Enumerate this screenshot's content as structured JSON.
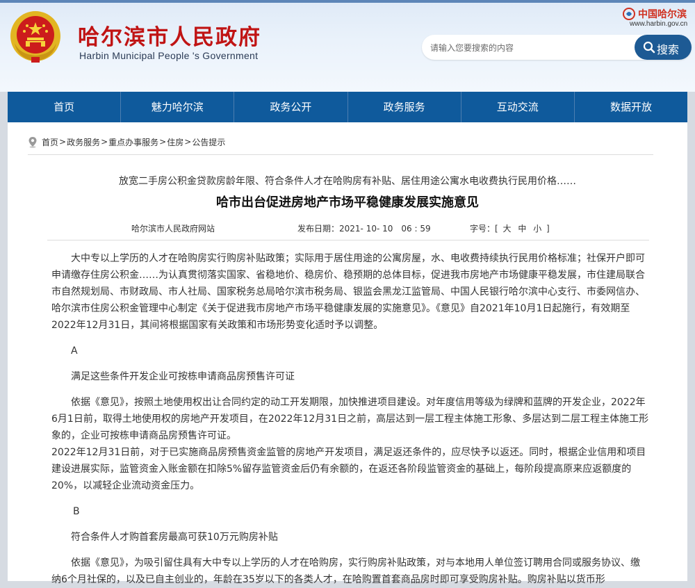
{
  "header": {
    "title_cn": "哈尔滨市人民政府",
    "title_en": "Harbin Municipal People 's Government",
    "china_logo_text": "中国哈尔滨",
    "site_url": "www.harbin.gov.cn"
  },
  "search": {
    "placeholder": "请输入您要搜索的内容",
    "button_label": "搜索"
  },
  "nav": {
    "items": [
      {
        "label": "首页"
      },
      {
        "label": "魅力哈尔滨"
      },
      {
        "label": "政务公开"
      },
      {
        "label": "政务服务"
      },
      {
        "label": "互动交流"
      },
      {
        "label": "数据开放"
      }
    ]
  },
  "breadcrumb": {
    "items": [
      "首页",
      "政务服务",
      "重点办事服务",
      "住房",
      "公告提示"
    ],
    "separator": ">"
  },
  "article": {
    "subtitle": "放宽二手房公积金贷款房龄年限、符合条件人才在哈购房有补贴、居住用途公寓水电收费执行民用价格……",
    "title": "哈市出台促进房地产市场平稳健康发展实施意见",
    "source": "哈尔滨市人民政府网站",
    "date_label": "发布日期：",
    "date": "2021- 10- 10　06 : 59",
    "font_label": "字号：[",
    "font_large": "大",
    "font_medium": "中",
    "font_small": "小",
    "font_close": "]",
    "paragraphs": {
      "intro": "大中专以上学历的人才在哈购房实行购房补贴政策；实际用于居住用途的公寓房屋，水、电收费持续执行民用价格标准；社保开户即可申请缴存住房公积金……为认真贯彻落实国家、省稳地价、稳房价、稳预期的总体目标，促进我市房地产市场健康平稳发展，市住建局联合市自然规划局、市财政局、市人社局、国家税务总局哈尔滨市税务局、银监会黑龙江监管局、中国人民银行哈尔滨中心支行、市委网信办、哈尔滨市住房公积金管理中心制定《关于促进我市房地产市场平稳健康发展的实施意见》。《意见》自2021年10月1日起施行，有效期至2022年12月31日，其间将根据国家有关政策和市场形势变化适时予以调整。",
      "label_a": "A",
      "heading_a": "满足这些条件开发企业可按栋申请商品房预售许可证",
      "body_a1": "依据《意见》，按照土地使用权出让合同约定的动工开发期限，加快推进项目建设。对年度信用等级为绿牌和蓝牌的开发企业，2022年6月1日前，取得土地使用权的房地产开发项目，在2022年12月31日之前，高层达到一层工程主体施工形象、多层达到二层工程主体施工形象的，企业可按栋申请商品房预售许可证。",
      "body_a2": "2022年12月31日前，对于已实施商品房预售资金监管的房地产开发项目，满足返还条件的，应尽快予以返还。同时，根据企业信用和项目建设进展实际，监管资金入账金额在扣除5%留存监管资金后仍有余额的，在返还各阶段监管资金的基础上，每阶段提高原来应返额度的20%，以减轻企业流动资金压力。",
      "label_b": "B",
      "heading_b": "符合条件人才购首套房最高可获10万元购房补贴",
      "body_b1": "依据《意见》，为吸引留住具有大中专以上学历的人才在哈购房，实行购房补贴政策，对与本地用人单位签订聘用合同或服务协议、缴纳6个月社保的，以及已自主创业的，年龄在35岁以下的各类人才，在哈购置首套商品房时即可享受购房补贴。购房补贴以货币形"
    }
  },
  "colors": {
    "title_red": "#c01414",
    "nav_blue": "#0f5a9c",
    "search_blue": "#1d5a94",
    "page_bg": "#d6dbe2"
  }
}
